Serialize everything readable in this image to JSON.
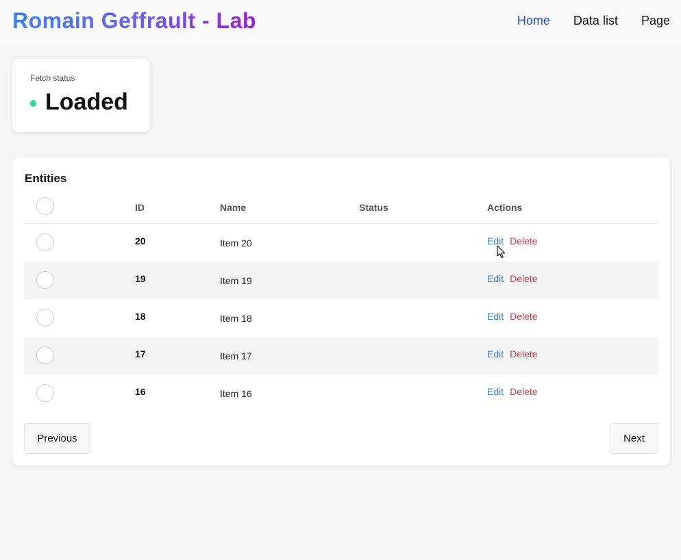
{
  "header": {
    "brand": "Romain Geffrault - Lab",
    "nav": [
      {
        "label": "Home"
      },
      {
        "label": "Data list"
      },
      {
        "label": "Page"
      }
    ]
  },
  "status_card": {
    "label": "Fetch status",
    "value": "Loaded",
    "dot_color": "#34d399"
  },
  "entities": {
    "title": "Entities",
    "columns": {
      "id": "ID",
      "name": "Name",
      "status": "Status",
      "actions": "Actions"
    },
    "rows": [
      {
        "id": "20",
        "name": "Item 20",
        "status": "",
        "edit": "Edit",
        "delete": "Delete"
      },
      {
        "id": "19",
        "name": "Item 19",
        "status": "",
        "edit": "Edit",
        "delete": "Delete"
      },
      {
        "id": "18",
        "name": "Item 18",
        "status": "",
        "edit": "Edit",
        "delete": "Delete"
      },
      {
        "id": "17",
        "name": "Item 17",
        "status": "",
        "edit": "Edit",
        "delete": "Delete"
      },
      {
        "id": "16",
        "name": "Item 16",
        "status": "",
        "edit": "Edit",
        "delete": "Delete"
      }
    ],
    "pagination": {
      "previous": "Previous",
      "next": "Next"
    }
  },
  "colors": {
    "brand_gradient_start": "#3b82f6",
    "brand_gradient_end": "#9b1fd6",
    "active_nav": "#1d4ed8",
    "edit_link": "#3b82c4",
    "delete_link": "#c23b4a"
  }
}
